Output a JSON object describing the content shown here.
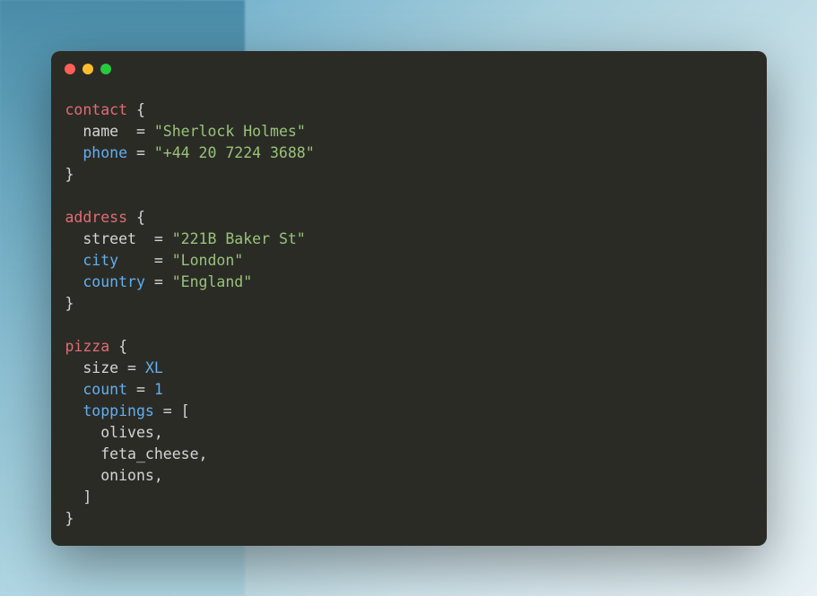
{
  "code": {
    "block1": {
      "keyword": "contact",
      "open": "{",
      "line1_key": "name",
      "line1_eq": "  = ",
      "line1_val": "\"Sherlock Holmes\"",
      "line2_key": "phone",
      "line2_eq": " = ",
      "line2_val": "\"+44 20 7224 3688\"",
      "close": "}"
    },
    "block2": {
      "keyword": "address",
      "open": "{",
      "line1_key": "street",
      "line1_eq": "  = ",
      "line1_val": "\"221B Baker St\"",
      "line2_key": "city",
      "line2_eq": "    = ",
      "line2_val": "\"London\"",
      "line3_key": "country",
      "line3_eq": " = ",
      "line3_val": "\"England\"",
      "close": "}"
    },
    "block3": {
      "keyword": "pizza",
      "open": "{",
      "line1_key": "size",
      "line1_eq": " = ",
      "line1_val": "XL",
      "line2_key": "count",
      "line2_eq": " = ",
      "line2_val": "1",
      "line3_key": "toppings",
      "line3_eq": " = ",
      "line3_open": "[",
      "item1": "olives",
      "comma": ",",
      "item2": "feta_cheese",
      "item3": "onions",
      "line3_close": "]",
      "close": "}"
    }
  }
}
